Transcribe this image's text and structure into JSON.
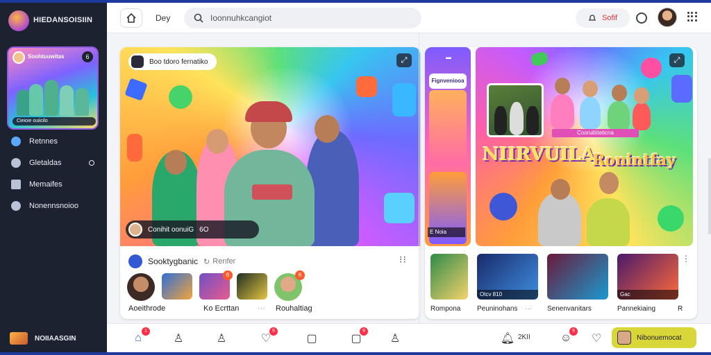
{
  "app": {
    "brand": "HIEDANSOISIIN",
    "footer_brand": "NOIIAASGIN"
  },
  "sidebar": {
    "mini_card": {
      "title": "Soohtuuwitas",
      "caption": "Cieioie ouiicilo",
      "icon": "6"
    },
    "items": [
      {
        "label": "Retnnes",
        "icon": "globe-icon"
      },
      {
        "label": "Gletaldas",
        "icon": "chat-icon"
      },
      {
        "label": "Memaifes",
        "icon": "square-icon"
      },
      {
        "label": "Nonennsnoioo",
        "icon": "circle-icon"
      }
    ]
  },
  "topbar": {
    "day_label": "Dey",
    "search_value": "Ioonnuhkcangiot",
    "pill_label": "Sofif"
  },
  "card1": {
    "chip_label": "Boo tdoro fernatiko",
    "caption": "Conihit oonuiG",
    "caption_icon": "6O",
    "channel": "Sooktygbanic",
    "refresh": "Renfer",
    "thumb_badge": "6",
    "thumb_labels": [
      "Aoeithrode",
      "Ko Ecrttan",
      "Rouhaltiag"
    ]
  },
  "card2": {
    "strip_label": "Fignveniooa",
    "strip_caption": "E Noia",
    "word_left": "NIIRVUILA",
    "word_right": "Ronintfay",
    "banner": "Cooruitiiteticna",
    "thumbs": [
      {
        "caption": "",
        "label": "Rompona"
      },
      {
        "caption": "Otcv 810",
        "label": "Peuninohans"
      },
      {
        "caption": "",
        "label": "Senenvanitars"
      },
      {
        "caption": "Gac",
        "label": "Pannekiaing"
      }
    ],
    "trailing_label": "R"
  },
  "bottombar": {
    "badges": [
      "1",
      "9",
      "9",
      "9"
    ],
    "text": "2KII",
    "cta_label": "Nibonuemocat"
  },
  "colors": {
    "accent": "#d9d63a",
    "badge": "#ff2d47",
    "sidebar": "#1c2230"
  }
}
